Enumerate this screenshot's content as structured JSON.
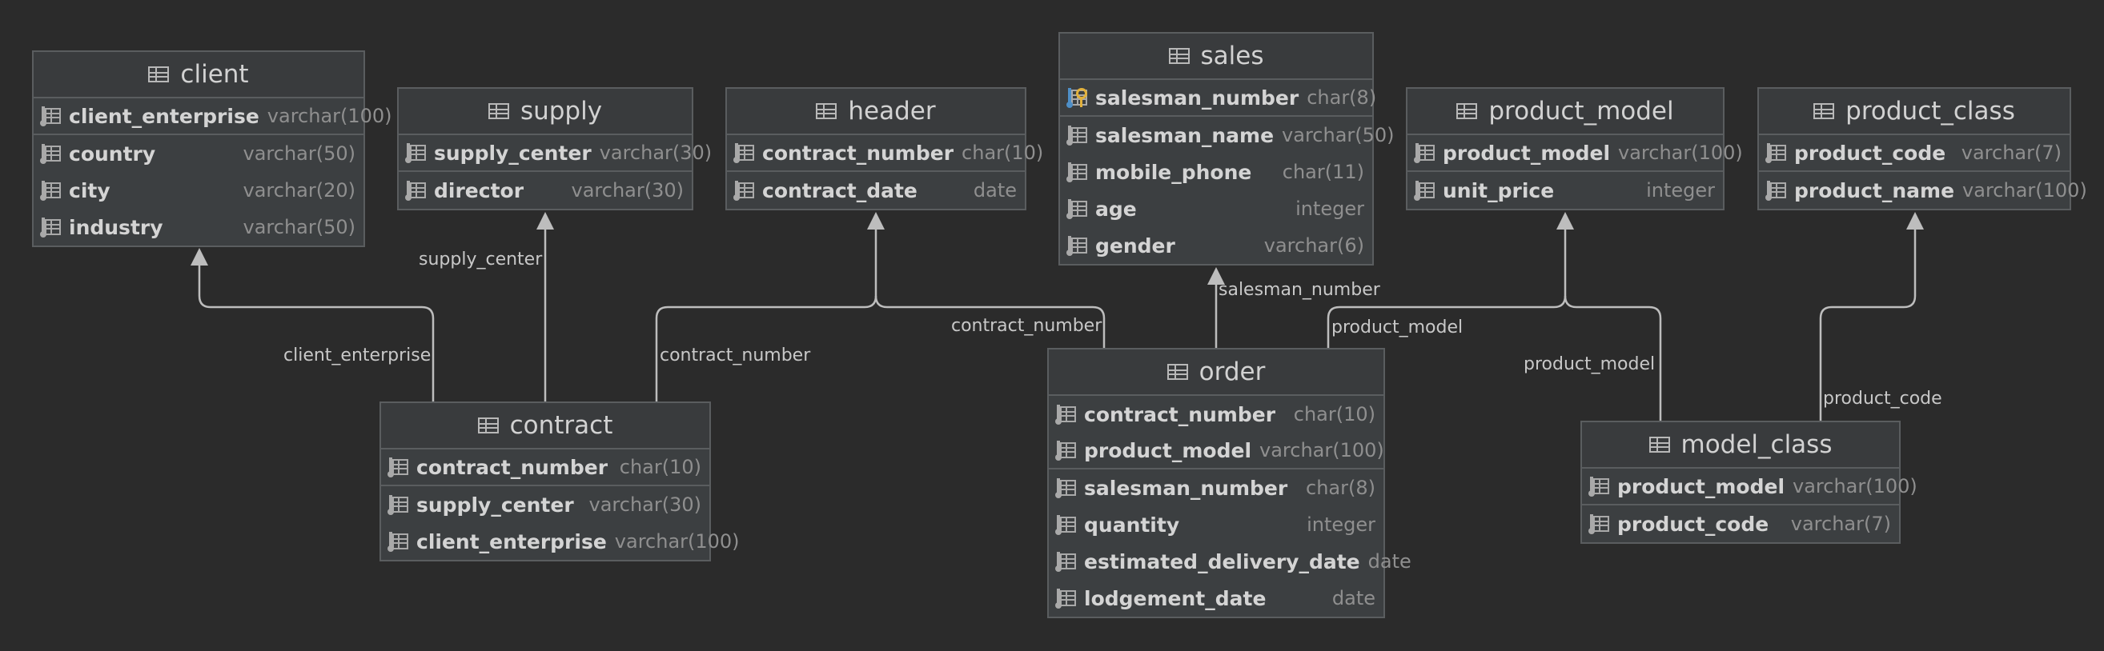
{
  "tables": {
    "client": {
      "name": "client",
      "columns": [
        {
          "name": "client_enterprise",
          "type": "varchar(100)"
        },
        {
          "name": "country",
          "type": "varchar(50)"
        },
        {
          "name": "city",
          "type": "varchar(20)"
        },
        {
          "name": "industry",
          "type": "varchar(50)"
        }
      ]
    },
    "supply": {
      "name": "supply",
      "columns": [
        {
          "name": "supply_center",
          "type": "varchar(30)"
        },
        {
          "name": "director",
          "type": "varchar(30)"
        }
      ]
    },
    "header": {
      "name": "header",
      "columns": [
        {
          "name": "contract_number",
          "type": "char(10)"
        },
        {
          "name": "contract_date",
          "type": "date"
        }
      ]
    },
    "sales": {
      "name": "sales",
      "columns": [
        {
          "name": "salesman_number",
          "type": "char(8)"
        },
        {
          "name": "salesman_name",
          "type": "varchar(50)"
        },
        {
          "name": "mobile_phone",
          "type": "char(11)"
        },
        {
          "name": "age",
          "type": "integer"
        },
        {
          "name": "gender",
          "type": "varchar(6)"
        }
      ]
    },
    "product_model": {
      "name": "product_model",
      "columns": [
        {
          "name": "product_model",
          "type": "varchar(100)"
        },
        {
          "name": "unit_price",
          "type": "integer"
        }
      ]
    },
    "product_class": {
      "name": "product_class",
      "columns": [
        {
          "name": "product_code",
          "type": "varchar(7)"
        },
        {
          "name": "product_name",
          "type": "varchar(100)"
        }
      ]
    },
    "contract": {
      "name": "contract",
      "columns": [
        {
          "name": "contract_number",
          "type": "char(10)"
        },
        {
          "name": "supply_center",
          "type": "varchar(30)"
        },
        {
          "name": "client_enterprise",
          "type": "varchar(100)"
        }
      ]
    },
    "order": {
      "name": "order",
      "columns": [
        {
          "name": "contract_number",
          "type": "char(10)"
        },
        {
          "name": "product_model",
          "type": "varchar(100)"
        },
        {
          "name": "salesman_number",
          "type": "char(8)"
        },
        {
          "name": "quantity",
          "type": "integer"
        },
        {
          "name": "estimated_delivery_date",
          "type": "date"
        },
        {
          "name": "lodgement_date",
          "type": "date"
        }
      ]
    },
    "model_class": {
      "name": "model_class",
      "columns": [
        {
          "name": "product_model",
          "type": "varchar(100)"
        },
        {
          "name": "product_code",
          "type": "varchar(7)"
        }
      ]
    }
  },
  "relations": [
    {
      "from": "contract",
      "to": "client",
      "label": "client_enterprise"
    },
    {
      "from": "contract",
      "to": "supply",
      "label": "supply_center"
    },
    {
      "from": "contract",
      "to": "header",
      "label": "contract_number"
    },
    {
      "from": "order",
      "to": "header",
      "label": "contract_number"
    },
    {
      "from": "order",
      "to": "sales",
      "label": "salesman_number"
    },
    {
      "from": "order",
      "to": "product_model",
      "label": "product_model"
    },
    {
      "from": "model_class",
      "to": "product_model",
      "label": "product_model"
    },
    {
      "from": "model_class",
      "to": "product_class",
      "label": "product_code"
    }
  ]
}
